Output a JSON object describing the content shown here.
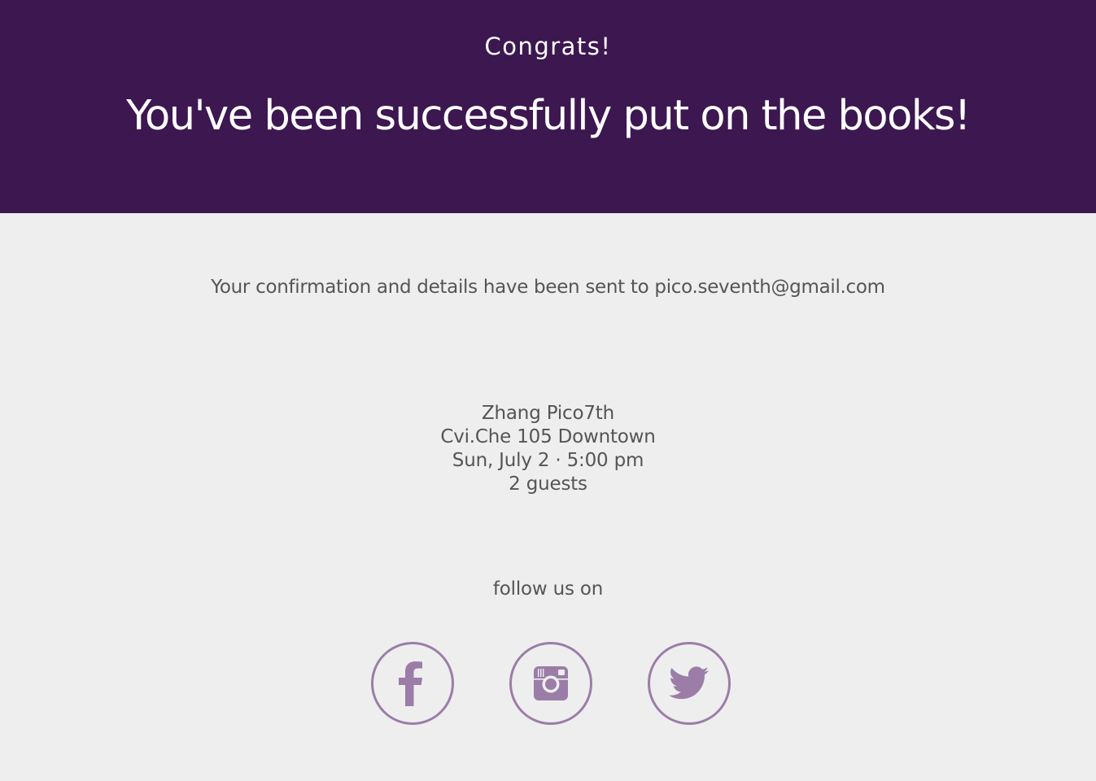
{
  "hero": {
    "kicker": "Congrats!",
    "headline": "You've been successfully put on the books!"
  },
  "confirmation": {
    "text": "Your confirmation and details have been sent to pico.seventh@gmail.com"
  },
  "reservation": {
    "name": "Zhang Pico7th",
    "restaurant": "Cvi.Che 105 Downtown",
    "datetime": "Sun, July 2 · 5:00 pm",
    "guests": "2 guests"
  },
  "social": {
    "label": "follow us on",
    "accent_color": "#9b7da8",
    "links": [
      {
        "icon": "facebook-icon"
      },
      {
        "icon": "instagram-icon"
      },
      {
        "icon": "twitter-icon"
      }
    ]
  },
  "colors": {
    "hero_background": "#3d1750",
    "page_background": "#eeeeee",
    "body_text": "#555555"
  }
}
